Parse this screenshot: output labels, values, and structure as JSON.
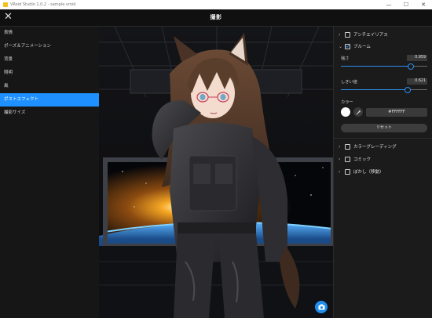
{
  "window": {
    "title": "VRoid Studio 1.0.2 - sample.vroid",
    "minimize": "—",
    "maximize": "☐",
    "close": "✕"
  },
  "header": {
    "close_glyph": "✕",
    "title": "撮影"
  },
  "sidebar": {
    "items": [
      {
        "label": "表情",
        "active": false
      },
      {
        "label": "ポーズ＆アニメーション",
        "active": false
      },
      {
        "label": "背景",
        "active": false
      },
      {
        "label": "照明",
        "active": false
      },
      {
        "label": "風",
        "active": false
      },
      {
        "label": "ポストエフェクト",
        "active": true
      },
      {
        "label": "撮影サイズ",
        "active": false
      }
    ]
  },
  "panel": {
    "antialias": {
      "label": "アンチエイリアス",
      "checked": false,
      "expanded": false
    },
    "bloom": {
      "label": "ブルーム",
      "checked": true,
      "expanded": true,
      "intensity": {
        "label": "強さ",
        "value": "0.959",
        "fraction": 0.81
      },
      "threshold": {
        "label": "しきい値",
        "value": "0.621",
        "fraction": 0.77
      },
      "color": {
        "label": "カラー",
        "hex": "#FFFFFF",
        "swatch": "#FFFFFF"
      },
      "reset_label": "リセット"
    },
    "color_grading": {
      "label": "カラーグレーディング",
      "checked": false,
      "expanded": false
    },
    "comic": {
      "label": "コミック",
      "checked": false,
      "expanded": false
    },
    "blur": {
      "label": "ぼかし（移動）",
      "checked": false,
      "expanded": false
    }
  },
  "colors": {
    "accent": "#1E90FF",
    "panel_bg": "#1B1B1B",
    "sidebar_bg": "#161616"
  },
  "icons": {
    "capture": "camera-icon",
    "eyedropper": "eyedropper-icon"
  }
}
